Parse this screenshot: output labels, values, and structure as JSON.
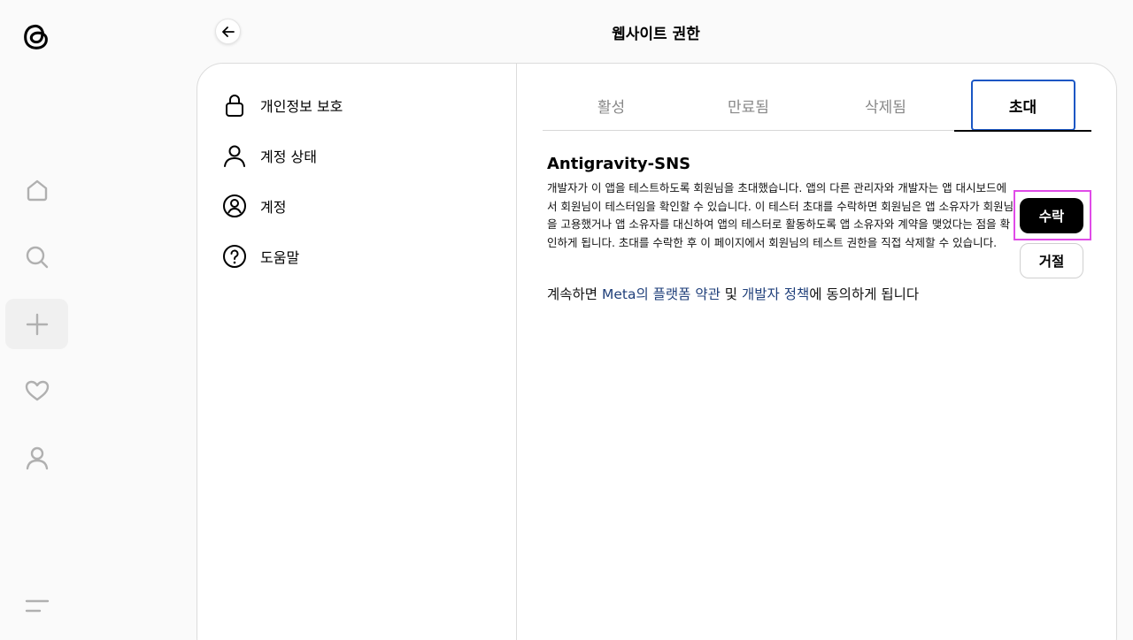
{
  "header": {
    "title": "웹사이트 권한"
  },
  "sidebar": {
    "items": [
      {
        "label": "개인정보 보호",
        "icon": "lock-icon"
      },
      {
        "label": "계정 상태",
        "icon": "person-icon"
      },
      {
        "label": "계정",
        "icon": "account-circle-icon"
      },
      {
        "label": "도움말",
        "icon": "help-icon"
      }
    ]
  },
  "tabs": [
    {
      "label": "활성"
    },
    {
      "label": "만료됨"
    },
    {
      "label": "삭제됨"
    },
    {
      "label": "초대",
      "active": true
    }
  ],
  "invite": {
    "app_name": "Antigravity-SNS",
    "description": "개발자가 이 앱을 테스트하도록 회원님을 초대했습니다. 앱의 다른 관리자와 개발자는 앱 대시보드에서 회원님이 테스터임을 확인할 수 있습니다. 이 테스터 초대를 수락하면 회원님은 앱 소유자가 회원님을 고용했거나 앱 소유자를 대신하여 앱의 테스터로 활동하도록 앱 소유자와 계약을 맺었다는 점을 확인하게 됩니다. 초대를 수락한 후 이 페이지에서 회원님의 테스트 권한을 직접 삭제할 수 있습니다.",
    "accept_label": "수락",
    "decline_label": "거절",
    "consent_prefix": "계속하면 ",
    "consent_link1": "Meta의 플랫폼 약관",
    "consent_mid": " 및 ",
    "consent_link2": "개발자 정책",
    "consent_suffix": "에 동의하게 됩니다"
  },
  "colors": {
    "accent_border": "#1a56c4",
    "link": "#1f3f7a",
    "highlight": "#e04be8"
  }
}
